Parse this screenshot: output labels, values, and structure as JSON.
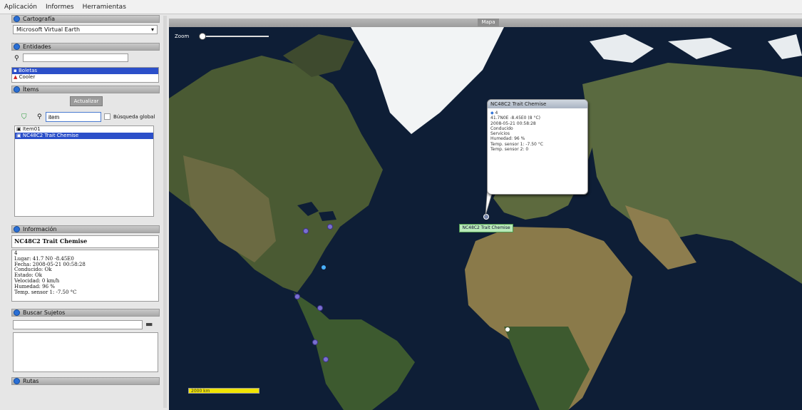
{
  "menu": {
    "items": [
      "Aplicación",
      "Informes",
      "Herramientas"
    ]
  },
  "cartography": {
    "header": "Cartografía",
    "selected_layer": "Microsoft Virtual Earth"
  },
  "entities": {
    "header": "Entidades",
    "search_value": "",
    "items": [
      {
        "label": "Boletas",
        "selected": true
      },
      {
        "label": "Cooler",
        "selected": false
      }
    ]
  },
  "items_panel": {
    "header": "Ítems",
    "button": "Actualizar",
    "search_value": "item",
    "global_label": "Búsqueda global",
    "list": [
      {
        "label": "Item01",
        "selected": false
      },
      {
        "label": "NC48C2 Trait Chemise",
        "selected": true
      }
    ]
  },
  "information": {
    "header": "Información",
    "title": "NC48C2 Trait Chemise",
    "lines": [
      "4",
      "Lugar: 41.7 N0 -8.45E0",
      "Fecha: 2008-05-21 00:58:28",
      "Conducido: Ok",
      "Estado: Ok",
      "Velocidad: 0 km/h",
      "Humedad: 96 %",
      "Temp. sensor 1: -7.50 °C"
    ]
  },
  "search_subjects": {
    "header": "Buscar Sujetos",
    "search_value": ""
  },
  "routes": {
    "header": "Rutas"
  },
  "map": {
    "title": "Mapa",
    "zoom_label": "Zoom",
    "popup": {
      "header": "NC48C2 Trait Chemise",
      "lines": [
        "4",
        "41.7N0E -8.45E0 (8 °C)",
        "2008-05-21 00:58:28",
        "Conducido",
        "Servicios",
        "Humedad: 96 %",
        "Temp. sensor 1: -7.50 °C",
        "Temp. sensor 2: 0"
      ]
    },
    "label": "NC48C2 Trait Chemise",
    "scale": "2000 km"
  }
}
